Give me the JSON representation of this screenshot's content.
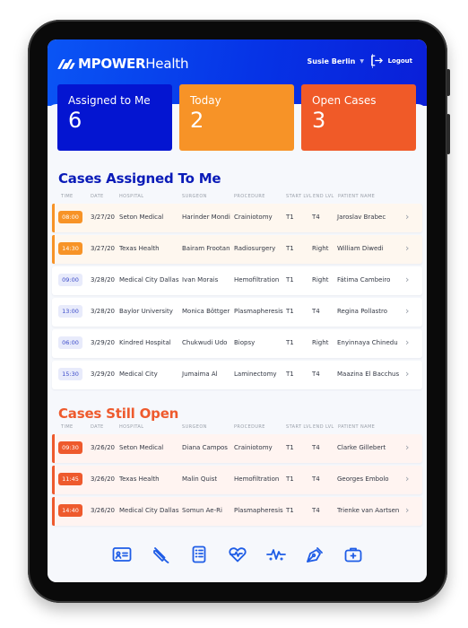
{
  "app": {
    "brand_bold": "MPOWER",
    "brand_light": "Health"
  },
  "header": {
    "user_name": "Susie Berlin",
    "logout_label": "Logout"
  },
  "cards": [
    {
      "label": "Assigned to Me",
      "value": "6",
      "color": "#0415d1"
    },
    {
      "label": "Today",
      "value": "2",
      "color": "#f79327"
    },
    {
      "label": "Open Cases",
      "value": "3",
      "color": "#f05a28"
    }
  ],
  "columns": {
    "time": "TIME",
    "date": "DATE",
    "hospital": "HOSPITAL",
    "surgeon": "SURGEON",
    "procedure": "PROCEDURE",
    "start_lvl": "START LVL",
    "end_lvl": "END LVL",
    "patient": "PATIENT NAME"
  },
  "assigned": {
    "title": "Cases Assigned To Me",
    "rows": [
      {
        "time": "08:00",
        "date": "3/27/20",
        "hospital": "Seton Medical",
        "surgeon": "Harinder Mondi",
        "procedure": "Crainiotomy",
        "start": "T1",
        "end": "T4",
        "patient": "Jaroslav Brabec",
        "status": "today"
      },
      {
        "time": "14:30",
        "date": "3/27/20",
        "hospital": "Texas Health",
        "surgeon": "Bairam Frootan",
        "procedure": "Radiosurgery",
        "start": "T1",
        "end": "Right",
        "patient": "William Diwedi",
        "status": "today"
      },
      {
        "time": "09:00",
        "date": "3/28/20",
        "hospital": "Medical City Dallas",
        "surgeon": "Ivan Morais",
        "procedure": "Hemofiltration",
        "start": "T1",
        "end": "Right",
        "patient": "Fátima Cambeiro",
        "status": "upcoming"
      },
      {
        "time": "13:00",
        "date": "3/28/20",
        "hospital": "Baylor University",
        "surgeon": "Monica Böttger",
        "procedure": "Plasmapheresis",
        "start": "T1",
        "end": "T4",
        "patient": "Regina Pollastro",
        "status": "upcoming"
      },
      {
        "time": "06:00",
        "date": "3/29/20",
        "hospital": "Kindred Hospital",
        "surgeon": "Chukwudi Udo",
        "procedure": "Biopsy",
        "start": "T1",
        "end": "Right",
        "patient": "Enyinnaya Chinedu",
        "status": "upcoming"
      },
      {
        "time": "15:30",
        "date": "3/29/20",
        "hospital": "Medical City",
        "surgeon": "Jumaima Al",
        "procedure": "Laminectomy",
        "start": "T1",
        "end": "T4",
        "patient": "Maazina El Bacchus",
        "status": "upcoming"
      }
    ]
  },
  "open": {
    "title": "Cases Still Open",
    "rows": [
      {
        "time": "09:30",
        "date": "3/26/20",
        "hospital": "Seton Medical",
        "surgeon": "Diana Campos",
        "procedure": "Crainiotomy",
        "start": "T1",
        "end": "T4",
        "patient": "Clarke Gillebert"
      },
      {
        "time": "11:45",
        "date": "3/26/20",
        "hospital": "Texas Health",
        "surgeon": "Malin Quist",
        "procedure": "Hemofiltration",
        "start": "T1",
        "end": "T4",
        "patient": "Georges Embolo"
      },
      {
        "time": "14:40",
        "date": "3/26/20",
        "hospital": "Medical City Dallas",
        "surgeon": "Somun Ae-Ri",
        "procedure": "Plasmapheresis",
        "start": "T1",
        "end": "T4",
        "patient": "Trienke van Aartsen"
      }
    ]
  },
  "nav_icons": [
    "id-card-icon",
    "syringe-icon",
    "checklist-icon",
    "heart-pulse-icon",
    "vitals-icon",
    "pen-nib-icon",
    "medical-kit-icon"
  ],
  "colors": {
    "primary": "#0415d1",
    "today": "#f79327",
    "open": "#f05a28",
    "icon": "#1e5ce6"
  }
}
